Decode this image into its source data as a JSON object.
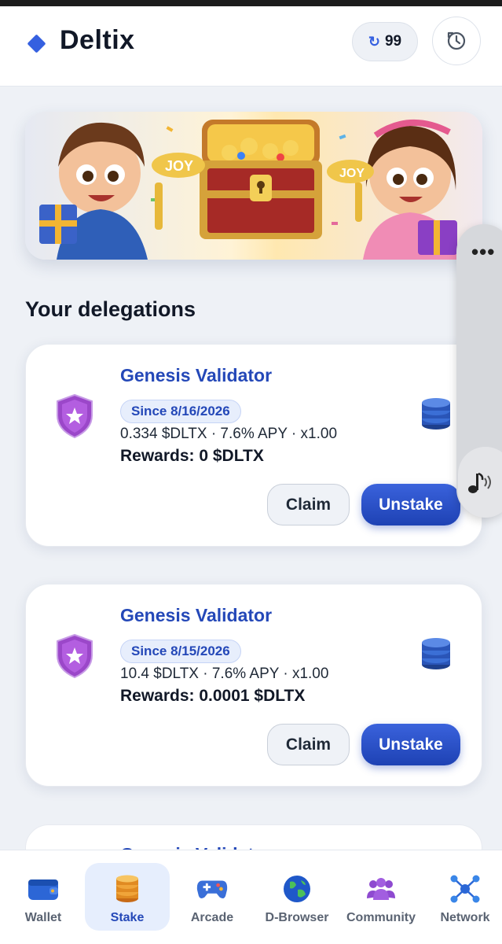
{
  "header": {
    "brand": "Deltix",
    "counter_value": "99",
    "counter_icon": "refresh-icon",
    "history_icon": "history-icon"
  },
  "banner": {
    "left_sign": "JOY",
    "right_sign": "JOY"
  },
  "section_title": "Your delegations",
  "delegations": [
    {
      "validator": "Genesis Validator",
      "since": "Since 8/16/2026",
      "details": "0.334 $DLTX · 7.6% APY · x1.00",
      "rewards": "Rewards: 0 $DLTX",
      "claim_label": "Claim",
      "unstake_label": "Unstake"
    },
    {
      "validator": "Genesis Validator",
      "since": "Since 8/15/2026",
      "details": "10.4 $DLTX · 7.6% APY · x1.00",
      "rewards": "Rewards: 0.0001 $DLTX",
      "claim_label": "Claim",
      "unstake_label": "Unstake"
    },
    {
      "validator": "Genesis Validator"
    }
  ],
  "nav": [
    {
      "label": "Wallet",
      "icon": "wallet-icon"
    },
    {
      "label": "Stake",
      "icon": "coin-stack-icon",
      "active": true
    },
    {
      "label": "Arcade",
      "icon": "gamepad-icon"
    },
    {
      "label": "D-Browser",
      "icon": "globe-icon"
    },
    {
      "label": "Community",
      "icon": "people-icon"
    },
    {
      "label": "Network",
      "icon": "network-icon"
    }
  ],
  "colors": {
    "accent": "#2448b8",
    "button_primary": "#2a52cc",
    "background": "#eef1f6",
    "shield": "#9b47c9"
  }
}
